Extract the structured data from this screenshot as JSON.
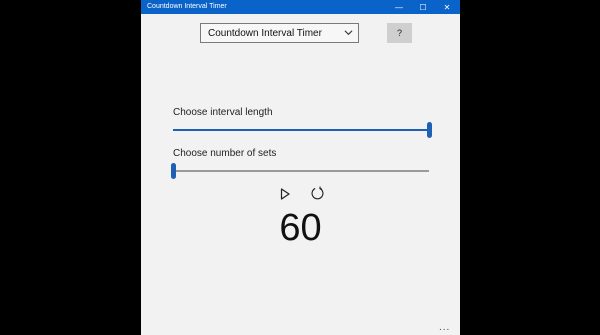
{
  "window": {
    "title": "Countdown Interval Timer",
    "minimize_glyph": "—",
    "maximize_glyph": "☐",
    "close_glyph": "✕"
  },
  "toolbar": {
    "mode_select": {
      "selected": "Countdown Interval Timer",
      "icon": "chevron-down-icon"
    },
    "help_label": "?"
  },
  "interval_length": {
    "label": "Choose interval length",
    "fraction": 1.0
  },
  "number_of_sets": {
    "label": "Choose number of sets",
    "fraction": 0.0
  },
  "controls": {
    "play_icon": "play-icon",
    "reset_icon": "restart-icon"
  },
  "timer": {
    "value": "60"
  },
  "more_label": "...",
  "colors": {
    "titlebar": "#0a63c9",
    "accent": "#1f5fb4",
    "background": "#f2f2f2"
  }
}
